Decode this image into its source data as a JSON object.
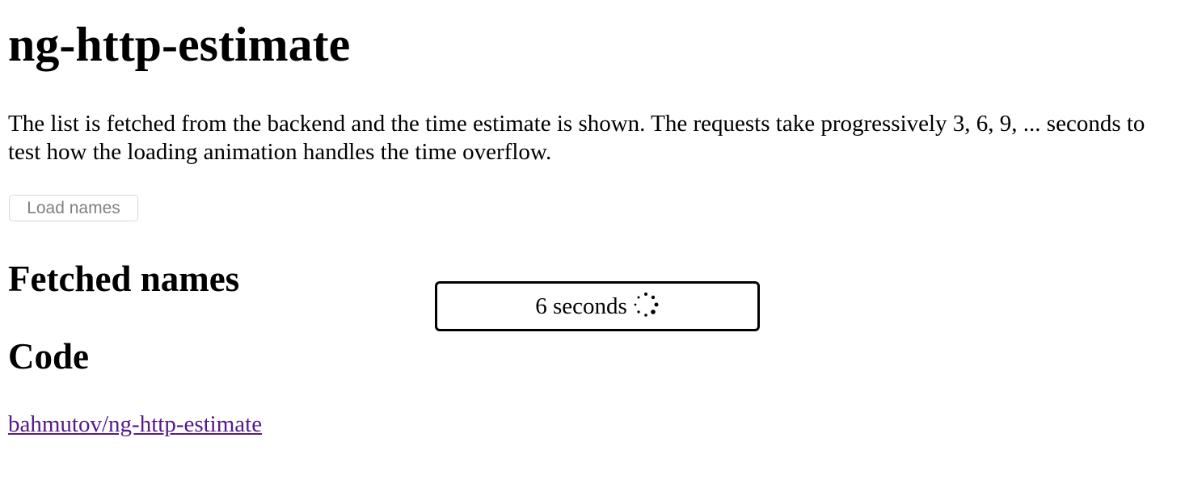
{
  "page": {
    "title": "ng-http-estimate",
    "intro": "The list is fetched from the backend and the time estimate is shown. The requests take progressively 3, 6, 9, ... seconds to test how the loading animation handles the time overflow.",
    "load_button_label": "Load names"
  },
  "sections": {
    "fetched_title": "Fetched names",
    "code_title": "Code",
    "repo_link_text": "bahmutov/ng-http-estimate"
  },
  "estimate": {
    "text": "6 seconds",
    "icon": "loading-spinner-icon"
  },
  "colors": {
    "link": "#551a8b",
    "button_text": "#808080",
    "button_border": "#d8d8d8"
  }
}
